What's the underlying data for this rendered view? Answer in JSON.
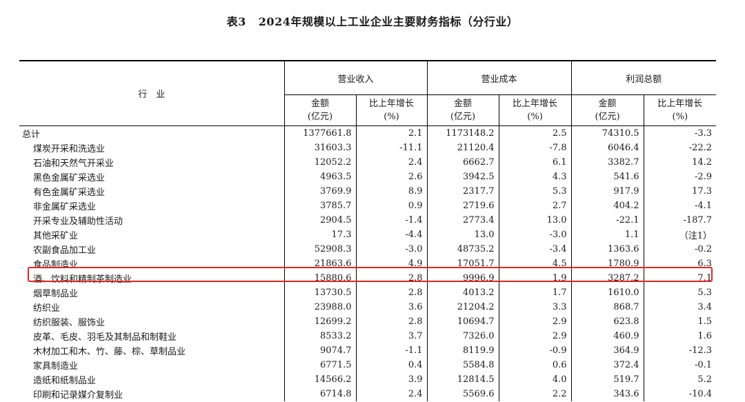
{
  "title": {
    "prefix": "表3",
    "text": "2024年规模以上工业企业主要财务指标（分行业）"
  },
  "header": {
    "industry": "行　业",
    "groups": [
      "营业收入",
      "营业成本",
      "利润总额"
    ],
    "amount_line1": "金额",
    "amount_line2": "(亿元)",
    "growth_line1": "比上年增长",
    "growth_line2": "(%)"
  },
  "highlight_color": "#e02424",
  "rows": [
    {
      "name": "总计",
      "v": [
        "1377661.8",
        "2.1",
        "1173148.2",
        "2.5",
        "74310.5",
        "-3.3"
      ],
      "total": true
    },
    {
      "name": "煤炭开采和洗选业",
      "v": [
        "31603.3",
        "-11.1",
        "21120.4",
        "-7.8",
        "6046.4",
        "-22.2"
      ]
    },
    {
      "name": "石油和天然气开采业",
      "v": [
        "12052.2",
        "2.4",
        "6662.7",
        "6.1",
        "3382.7",
        "14.2"
      ]
    },
    {
      "name": "黑色金属矿采选业",
      "v": [
        "4963.5",
        "2.6",
        "3942.5",
        "4.3",
        "541.6",
        "-2.9"
      ]
    },
    {
      "name": "有色金属矿采选业",
      "v": [
        "3769.9",
        "8.9",
        "2317.7",
        "5.3",
        "917.9",
        "17.3"
      ]
    },
    {
      "name": "非金属矿采选业",
      "v": [
        "3785.7",
        "0.9",
        "2719.6",
        "2.7",
        "404.2",
        "-4.1"
      ]
    },
    {
      "name": "开采专业及辅助性活动",
      "v": [
        "2904.5",
        "-1.4",
        "2773.4",
        "13.0",
        "-22.1",
        "-187.7"
      ]
    },
    {
      "name": "其他采矿业",
      "v": [
        "17.3",
        "-4.4",
        "13.0",
        "-3.0",
        "1.1",
        "（注1）"
      ]
    },
    {
      "name": "农副食品加工业",
      "v": [
        "52908.3",
        "-3.0",
        "48735.2",
        "-3.4",
        "1363.6",
        "-0.2"
      ]
    },
    {
      "name": "食品制造业",
      "v": [
        "21863.6",
        "4.9",
        "17051.7",
        "4.5",
        "1780.9",
        "6.3"
      ]
    },
    {
      "name": "酒、饮料和精制茶制造业",
      "v": [
        "15880.6",
        "2.8",
        "9996.9",
        "1.9",
        "3287.2",
        "7.1"
      ],
      "highlight": true
    },
    {
      "name": "烟草制品业",
      "v": [
        "13730.5",
        "2.8",
        "4013.2",
        "1.7",
        "1610.0",
        "5.3"
      ]
    },
    {
      "name": "纺织业",
      "v": [
        "23988.0",
        "3.6",
        "21204.2",
        "3.3",
        "868.7",
        "3.4"
      ]
    },
    {
      "name": "纺织服装、服饰业",
      "v": [
        "12699.2",
        "2.8",
        "10694.7",
        "2.9",
        "623.8",
        "1.5"
      ]
    },
    {
      "name": "皮革、毛皮、羽毛及其制品和制鞋业",
      "v": [
        "8533.2",
        "3.7",
        "7326.0",
        "2.9",
        "460.9",
        "1.6"
      ]
    },
    {
      "name": "木材加工和木、竹、藤、棕、草制品业",
      "v": [
        "9074.7",
        "-1.1",
        "8119.9",
        "-0.9",
        "364.9",
        "-12.3"
      ]
    },
    {
      "name": "家具制造业",
      "v": [
        "6771.5",
        "0.4",
        "5584.8",
        "0.6",
        "372.4",
        "-0.1"
      ]
    },
    {
      "name": "造纸和纸制品业",
      "v": [
        "14566.2",
        "3.9",
        "12814.5",
        "4.0",
        "519.7",
        "5.2"
      ]
    },
    {
      "name": "印刷和记录媒介复制业",
      "v": [
        "6714.8",
        "2.4",
        "5569.6",
        "2.2",
        "343.6",
        "-10.4"
      ]
    }
  ]
}
